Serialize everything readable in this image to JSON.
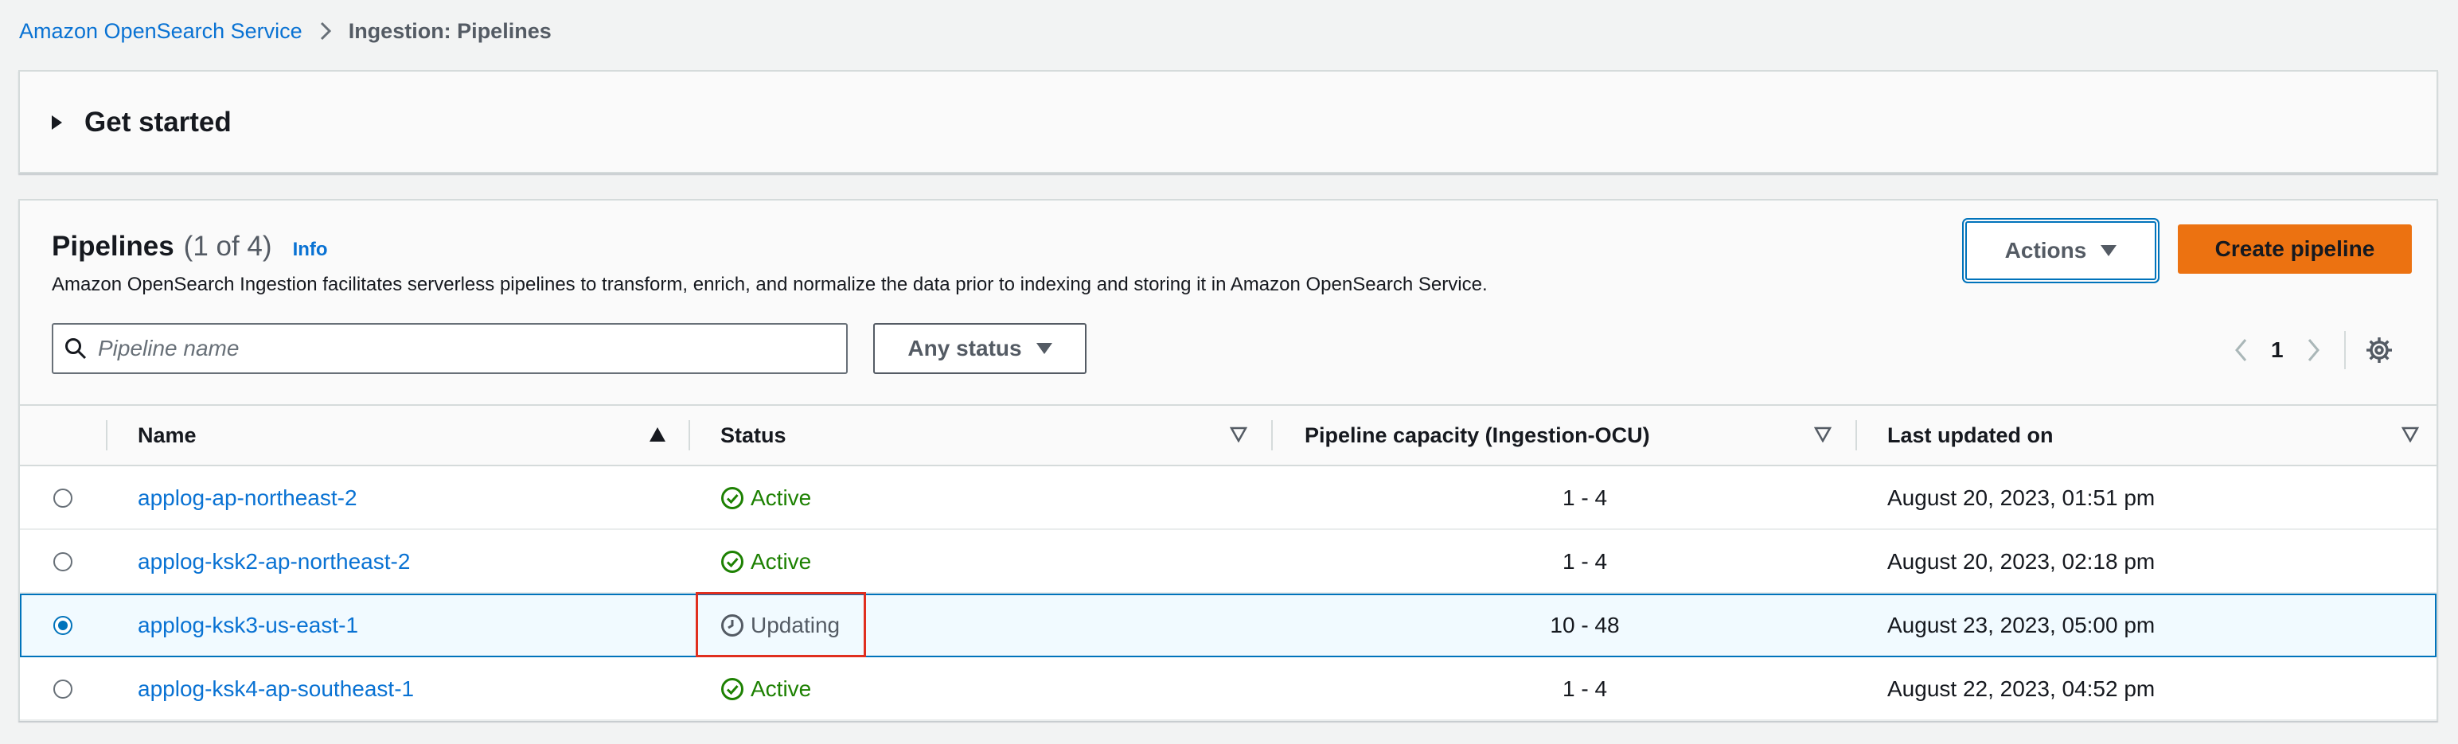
{
  "breadcrumb": {
    "service": "Amazon OpenSearch Service",
    "current": "Ingestion: Pipelines"
  },
  "get_started": {
    "label": "Get started"
  },
  "pipelines": {
    "title": "Pipelines",
    "count": "(1 of 4)",
    "info": "Info",
    "description": "Amazon OpenSearch Ingestion facilitates serverless pipelines to transform, enrich, and normalize the data prior to indexing and storing it in Amazon OpenSearch Service.",
    "actions_label": "Actions",
    "create_label": "Create pipeline"
  },
  "filter": {
    "search_placeholder": "Pipeline name",
    "search_value": "",
    "status_label": "Any status"
  },
  "pagination": {
    "current_page": "1"
  },
  "table": {
    "columns": {
      "name": "Name",
      "status": "Status",
      "capacity": "Pipeline capacity (Ingestion-OCU)",
      "updated": "Last updated on"
    },
    "rows": [
      {
        "name": "applog-ap-northeast-2",
        "status": "Active",
        "capacity": "1 - 4",
        "updated": "August 20, 2023, 01:51 pm",
        "selected": false
      },
      {
        "name": "applog-ksk2-ap-northeast-2",
        "status": "Active",
        "capacity": "1 - 4",
        "updated": "August 20, 2023, 02:18 pm",
        "selected": false
      },
      {
        "name": "applog-ksk3-us-east-1",
        "status": "Updating",
        "capacity": "10 - 48",
        "updated": "August 23, 2023, 05:00 pm",
        "selected": true
      },
      {
        "name": "applog-ksk4-ap-southeast-1",
        "status": "Active",
        "capacity": "1 - 4",
        "updated": "August 22, 2023, 04:52 pm",
        "selected": false
      }
    ]
  },
  "colors": {
    "link": "#0972d3",
    "active": "#1d8102",
    "primary_button": "#ec7211",
    "selected_row_border": "#0073bb",
    "highlight_box": "#e02f1f"
  }
}
